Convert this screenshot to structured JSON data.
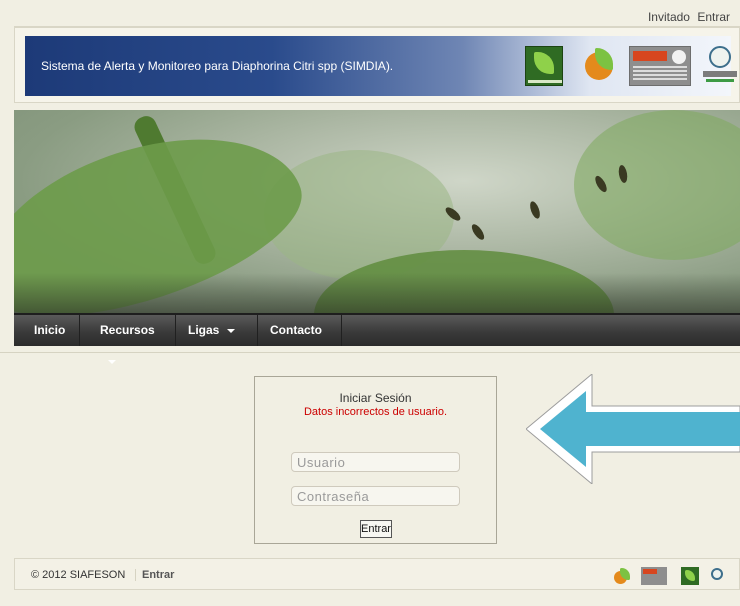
{
  "topbar": {
    "user": "Invitado",
    "login_link": "Entrar"
  },
  "header": {
    "title": "Sistema de Alerta y Monitoreo para Diaphorina Citri spp (SIMDIA).",
    "logos": [
      "siafeson-logo",
      "hoja-logo",
      "sagarpa-logo",
      "senasica-logo"
    ]
  },
  "nav": {
    "items": [
      {
        "label": "Inicio",
        "has_dropdown": false
      },
      {
        "label": "Recursos",
        "has_dropdown": true
      },
      {
        "label": "Ligas",
        "has_dropdown": true
      },
      {
        "label": "Contacto",
        "has_dropdown": false
      }
    ]
  },
  "login": {
    "title": "Iniciar Sesión",
    "error": "Datos incorrectos de usuario.",
    "username_placeholder": "Usuario",
    "password_placeholder": "Contraseña",
    "submit_label": "Entrar"
  },
  "footer": {
    "copyright": "© 2012 SIAFESON",
    "link": "Entrar"
  },
  "colors": {
    "banner": "#1d3a78",
    "arrow_fill": "#4fb3cf",
    "error": "#cc0000",
    "nav_bg": "#3a3a3a"
  }
}
